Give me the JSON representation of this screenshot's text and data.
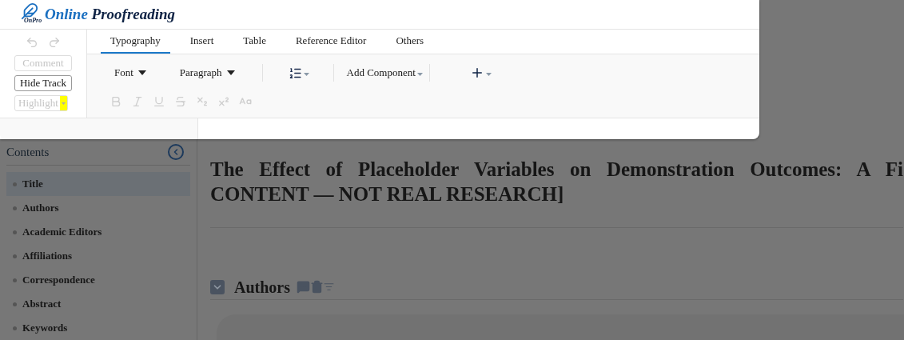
{
  "logo": {
    "mark": "OnPro",
    "words": [
      "Online",
      "Proofreading"
    ]
  },
  "history": {
    "undo_disabled": true,
    "redo_disabled": true
  },
  "side_buttons": [
    {
      "label": "Comment",
      "disabled": true,
      "kind": "plain"
    },
    {
      "label": "Hide Track",
      "disabled": false,
      "kind": "plain"
    },
    {
      "label": "Highlight",
      "disabled": true,
      "kind": "color",
      "color": "#ffff00"
    }
  ],
  "tabs": [
    {
      "label": "Typography",
      "selected": true
    },
    {
      "label": "Insert",
      "selected": false
    },
    {
      "label": "Table",
      "selected": false
    },
    {
      "label": "Reference Editor",
      "selected": false
    },
    {
      "label": "Others",
      "selected": false
    }
  ],
  "toolbar": [
    {
      "kind": "menu",
      "label": "Font"
    },
    {
      "kind": "menu",
      "label": "Paragraph"
    },
    {
      "kind": "list"
    },
    {
      "kind": "dropdown",
      "label": "Add Component"
    },
    {
      "kind": "plus"
    }
  ],
  "format_buttons": [
    {
      "kind": "bold",
      "disabled": true
    },
    {
      "kind": "italic",
      "disabled": true
    },
    {
      "kind": "underline",
      "disabled": true
    },
    {
      "kind": "strike",
      "disabled": true
    },
    {
      "kind": "subscript",
      "disabled": true
    },
    {
      "kind": "superscript",
      "disabled": true
    },
    {
      "kind": "case",
      "disabled": true
    }
  ],
  "sidebar": {
    "title": "Contents",
    "items": [
      {
        "label": "Title",
        "selected": true
      },
      {
        "label": "Authors",
        "selected": false
      },
      {
        "label": "Academic Editors",
        "selected": false
      },
      {
        "label": "Affiliations",
        "selected": false
      },
      {
        "label": "Correspondence",
        "selected": false
      },
      {
        "label": "Abstract",
        "selected": false
      },
      {
        "label": "Keywords",
        "selected": false
      }
    ]
  },
  "document": {
    "title_lines": [
      "The Effect of Placeholder Variables on Demonstration Outcomes: A Fi",
      "CONTENT — NOT REAL RESEARCH]"
    ],
    "section": {
      "title": "Authors",
      "expanded": true
    }
  }
}
